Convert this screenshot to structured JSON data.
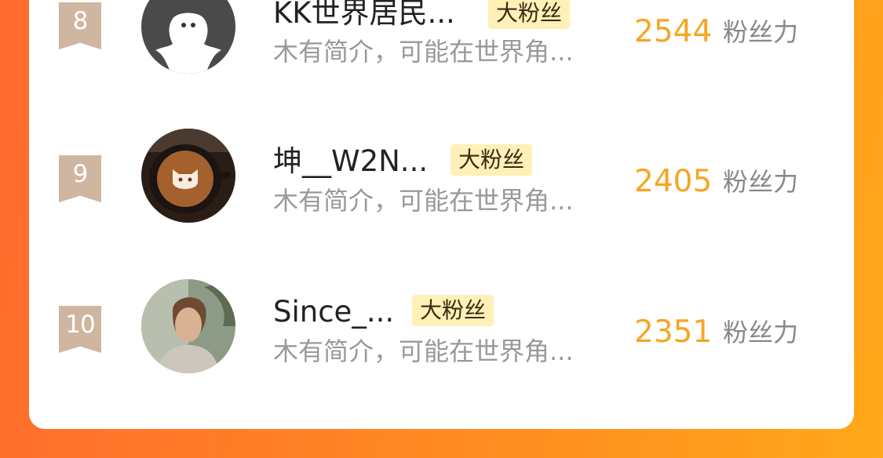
{
  "rows": [
    {
      "rank": "8",
      "avatar_icon": "ghost-avatar-icon",
      "name": "KK世界居民...",
      "badge": "大粉丝",
      "bio": "木有简介，可能在世界角...",
      "score": "2544",
      "score_unit": "粉丝力"
    },
    {
      "rank": "9",
      "avatar_icon": "latte-art-cat-icon",
      "name": "坤__W2N...",
      "badge": "大粉丝",
      "bio": "木有简介，可能在世界角...",
      "score": "2405",
      "score_unit": "粉丝力"
    },
    {
      "rank": "10",
      "avatar_icon": "person-photo-icon",
      "name": "Since_...",
      "badge": "大粉丝",
      "bio": "木有简介，可能在世界角...",
      "score": "2351",
      "score_unit": "粉丝力"
    }
  ],
  "colors": {
    "score": "#f5a623",
    "badge_bg": "#fff0b8",
    "rank_flag": "#cfb6a1"
  }
}
